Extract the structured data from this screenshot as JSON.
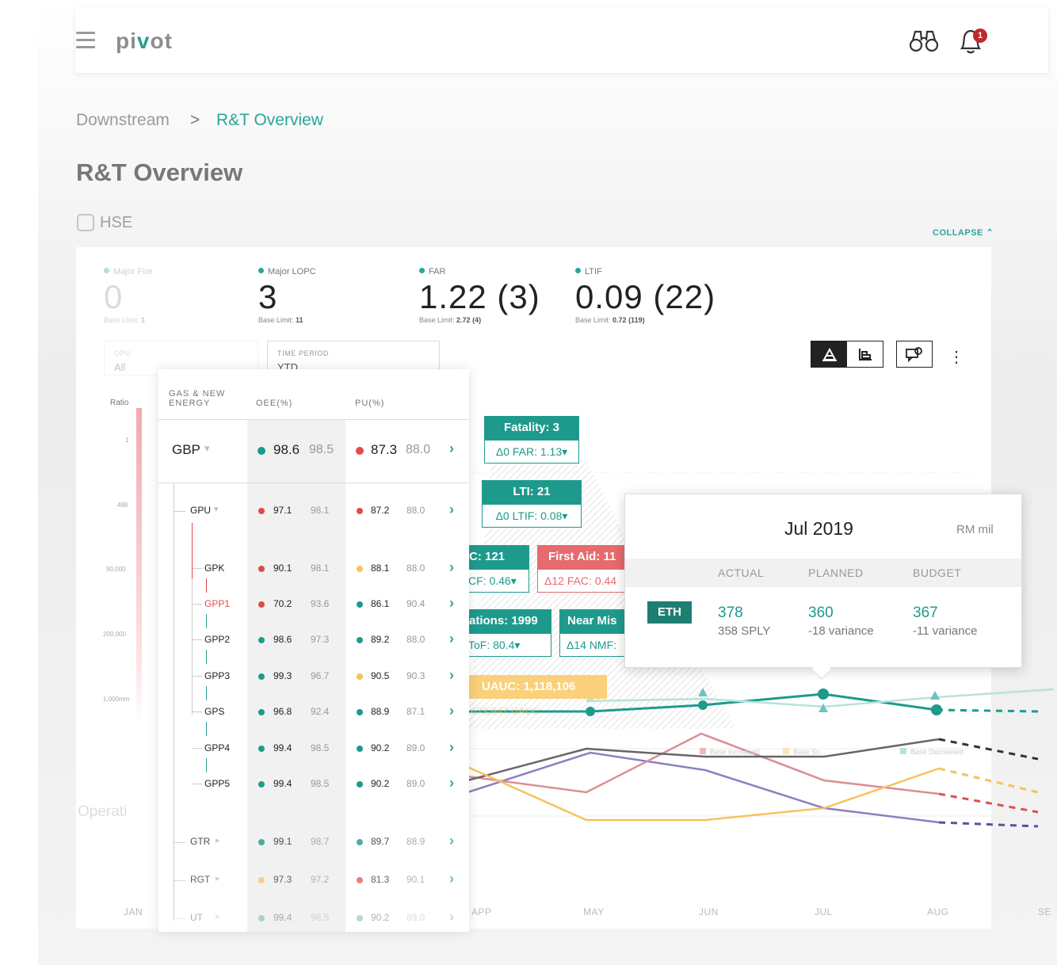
{
  "app": {
    "logo_pre": "pi",
    "logo_v": "v",
    "logo_post": "ot",
    "notifications": "1"
  },
  "breadcrumb": {
    "parent": "Downstream",
    "sep": ">",
    "current": "R&T Overview"
  },
  "page_title": "R&T Overview",
  "section": {
    "label": "HSE",
    "collapse": "COLLAPSE ⌃"
  },
  "kpis": [
    {
      "label": "Major Fire",
      "value": "0",
      "base_text": "Base Limit:",
      "base_val": "1"
    },
    {
      "label": "Major LOPC",
      "value": "3",
      "base_text": "Base Limit:",
      "base_val": "11"
    },
    {
      "label": "FAR",
      "value": "1.22 (3)",
      "base_text": "Base Limit:",
      "base_val": "2.72 (4)"
    },
    {
      "label": "LTIF",
      "value": "0.09 (22)",
      "base_text": "Base Limit:",
      "base_val": "0.72 (119)"
    }
  ],
  "filters": {
    "opu_label": "OPU",
    "opu_value": "All",
    "period_label": "TIME PERIOD",
    "period_value": "YTD"
  },
  "ratio": {
    "label": "Ratio",
    "ticks": [
      "1",
      "488",
      "90,000",
      "200,000",
      "1,000mm"
    ]
  },
  "table": {
    "head_group": "GAS & NEW\nENERGY",
    "head_oee": "OEE(%)",
    "head_pu": "PU(%)",
    "gbp": {
      "name": "GBP",
      "oee_a": "98.6",
      "oee_b": "98.5",
      "pu_a": "87.3",
      "pu_b": "88.0"
    },
    "rows": [
      {
        "name": "GPU",
        "oee_a": "97.1",
        "oee_b": "98.1",
        "pu_a": "87.2",
        "pu_b": "88.0"
      },
      {
        "name": "GPK",
        "oee_a": "90.1",
        "oee_b": "98.1",
        "pu_a": "88.1",
        "pu_b": "88.0"
      },
      {
        "name": "GPP1",
        "oee_a": "70.2",
        "oee_b": "93.6",
        "pu_a": "86.1",
        "pu_b": "90.4"
      },
      {
        "name": "GPP2",
        "oee_a": "98.6",
        "oee_b": "97.3",
        "pu_a": "89.2",
        "pu_b": "88.0"
      },
      {
        "name": "GPP3",
        "oee_a": "99.3",
        "oee_b": "96.7",
        "pu_a": "90.5",
        "pu_b": "90.3"
      },
      {
        "name": "GPS",
        "oee_a": "96.8",
        "oee_b": "92.4",
        "pu_a": "88.9",
        "pu_b": "87.1"
      },
      {
        "name": "GPP4",
        "oee_a": "99.4",
        "oee_b": "98.5",
        "pu_a": "90.2",
        "pu_b": "89.0"
      },
      {
        "name": "GPP5",
        "oee_a": "99.4",
        "oee_b": "98.5",
        "pu_a": "90.2",
        "pu_b": "89.0"
      },
      {
        "name": "GTR",
        "oee_a": "99.1",
        "oee_b": "98.7",
        "pu_a": "89.7",
        "pu_b": "88.9"
      },
      {
        "name": "RGT",
        "oee_a": "97.3",
        "oee_b": "97.2",
        "pu_a": "81.3",
        "pu_b": "90.1"
      },
      {
        "name": "UT",
        "oee_a": "99.4",
        "oee_b": "98.5",
        "pu_a": "90.2",
        "pu_b": "89.0"
      }
    ]
  },
  "tags": {
    "fatality_top": "Fatality: 3",
    "fatality_bot": "Δ0  FAR: 1.13▾",
    "lti_top": "LTI: 21",
    "lti_bot": "Δ0  LTIF: 0.08▾",
    "c_top": "C: 121",
    "c_bot": "CF: 0.46▾",
    "fa_top": "First Aid: 11",
    "fa_bot": "Δ12  FAC: 0.44",
    "obs_top": "ations: 1999",
    "obs_bot": "ToF: 80.4▾",
    "nm_top": "Near Mis",
    "nm_bot": "Δ14 NMF:",
    "uauc": "UAUC: 1,118,106",
    "uauc_sub": "673,947 UAUC"
  },
  "popup": {
    "month": "Jul 2019",
    "unit": "RM mil",
    "col_actual": "ACTUAL",
    "col_planned": "PLANNED",
    "col_budget": "BUDGET",
    "badge": "ETH",
    "actual": "378",
    "actual_sub": "358 SPLY",
    "planned": "360",
    "planned_sub": "-18 variance",
    "budget": "367",
    "budget_sub": "-11 variance"
  },
  "legend": [
    "Base Increased",
    "Base Sc...",
    "Base Decreased"
  ],
  "xaxis": [
    "JAN",
    "APP",
    "MAY",
    "JUN",
    "JUL",
    "AUG",
    "SE"
  ],
  "bg_section": "Operati",
  "colors": {
    "teal": "#1e9a8d",
    "red": "#e66a6e",
    "amber": "#fbd07a",
    "navy": "#5b4fa0"
  }
}
